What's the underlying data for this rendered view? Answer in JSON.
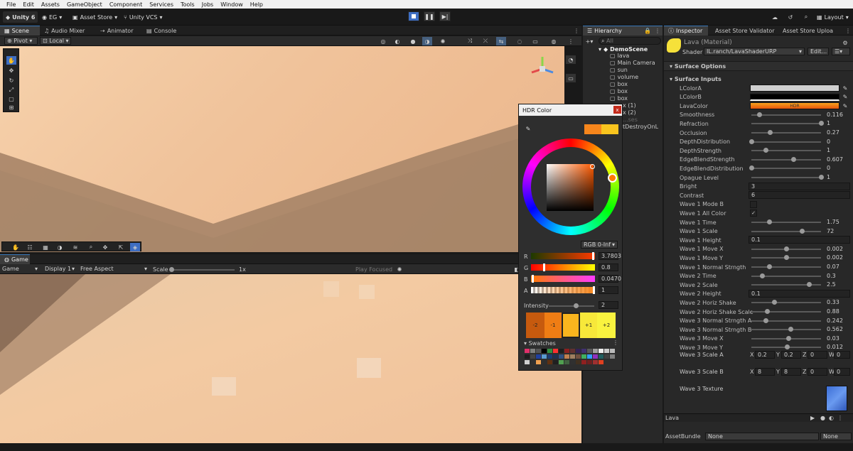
{
  "menu": [
    "File",
    "Edit",
    "Assets",
    "GameObject",
    "Component",
    "Services",
    "Tools",
    "Jobs",
    "Window",
    "Help"
  ],
  "toolbar": {
    "unity": "Unity 6",
    "account": "EG",
    "asset_store": "Asset Store",
    "vcs": "Unity VCS",
    "layout": "Layout"
  },
  "left_tabs": [
    "Scene",
    "Audio Mixer",
    "Animator",
    "Console"
  ],
  "scene_bar": {
    "pivot": "Pivot",
    "local": "Local"
  },
  "game_tab": "Game",
  "game_bar": {
    "mode": "Game",
    "display": "Display 1",
    "aspect": "Free Aspect",
    "scale_label": "Scale",
    "scale_value": "1x",
    "play_focused": "Play Focused"
  },
  "hierarchy": {
    "tab": "Hierarchy",
    "search_placeholder": "All",
    "scene": "DemoScene",
    "items": [
      "lava",
      "Main Camera",
      "sun",
      "volume",
      "box",
      "box",
      "box",
      "x (1)",
      "x (2)",
      "...ses",
      "tDestroyOnL"
    ]
  },
  "inspector": {
    "tabs": [
      "Inspector",
      "Asset Store Validator",
      "Asset Store Uploa"
    ],
    "material_name": "Lava (Material)",
    "shader_label": "Shader",
    "shader_value": "IL.ranch/LavaShaderURP",
    "edit_label": "Edit...",
    "surface_options": "Surface Options",
    "surface_inputs": "Surface Inputs",
    "hdr_label": "HDR",
    "props": [
      {
        "label": "LColorA",
        "type": "color",
        "color": "#cfcfcf"
      },
      {
        "label": "LColorB",
        "type": "color",
        "color": "#000000"
      },
      {
        "label": "LavaColor",
        "type": "hdr",
        "color": "#f7a21e"
      },
      {
        "label": "Smoothness",
        "type": "slider",
        "pos": 0.116,
        "value": "0.116"
      },
      {
        "label": "Refraction",
        "type": "slider",
        "pos": 1,
        "value": "1"
      },
      {
        "label": "Occlusion",
        "type": "slider",
        "pos": 0.27,
        "value": "0.27"
      },
      {
        "label": "DepthDistribution",
        "type": "slider",
        "pos": 0,
        "value": "0"
      },
      {
        "label": "DepthStrength",
        "type": "slider",
        "pos": 0.2,
        "value": "1"
      },
      {
        "label": "EdgeBlendStrength",
        "type": "slider",
        "pos": 0.607,
        "value": "0.607"
      },
      {
        "label": "EdgeBlendDistribution",
        "type": "slider",
        "pos": 0,
        "value": "0"
      },
      {
        "label": "Opague Level",
        "type": "slider",
        "pos": 1,
        "value": "1"
      },
      {
        "label": "Bright",
        "type": "field",
        "value": "3"
      },
      {
        "label": "Contrast",
        "type": "field",
        "value": "6"
      },
      {
        "label": "Wave 1 Mode B",
        "type": "check",
        "value": ""
      },
      {
        "label": "Wave 1 All Color",
        "type": "check",
        "value": "✓"
      },
      {
        "label": "Wave 1 Time",
        "type": "slider",
        "pos": 0.25,
        "value": "1.75"
      },
      {
        "label": "Wave 1 Scale",
        "type": "slider",
        "pos": 0.72,
        "value": "72"
      },
      {
        "label": "Wave 1 Height",
        "type": "field",
        "value": "0.1"
      },
      {
        "label": "Wave 1 Move X",
        "type": "slider",
        "pos": 0.5,
        "value": "0.002"
      },
      {
        "label": "Wave 1 Move Y",
        "type": "slider",
        "pos": 0.5,
        "value": "0.002"
      },
      {
        "label": "Wave 1 Normal Strngth",
        "type": "slider",
        "pos": 0.25,
        "value": "0.07"
      },
      {
        "label": "Wave 2 Time",
        "type": "slider",
        "pos": 0.15,
        "value": "0.3"
      },
      {
        "label": "Wave 2 Scale",
        "type": "slider",
        "pos": 0.83,
        "value": "2.5"
      },
      {
        "label": "Wave 2 Height",
        "type": "field",
        "value": "0.1"
      },
      {
        "label": "Wave 2 Horiz Shake",
        "type": "slider",
        "pos": 0.33,
        "value": "0.33"
      },
      {
        "label": "Wave 2 Horiz Shake Scale",
        "type": "slider",
        "pos": 0.22,
        "value": "0.88"
      },
      {
        "label": "Wave 3 Normal Strngth A",
        "type": "slider",
        "pos": 0.2,
        "value": "0.242"
      },
      {
        "label": "Wave 3 Normal Strngth B",
        "type": "slider",
        "pos": 0.56,
        "value": "0.562"
      },
      {
        "label": "Wave 3 Move X",
        "type": "slider",
        "pos": 0.53,
        "value": "0.03"
      },
      {
        "label": "Wave 3 Move Y",
        "type": "slider",
        "pos": 0.51,
        "value": "0.012"
      }
    ],
    "scale_a": {
      "label": "Wave 3 Scale A",
      "x": "0.2",
      "y": "0.2",
      "z": "0",
      "w": "0"
    },
    "scale_b": {
      "label": "Wave 3 Scale B",
      "x": "8",
      "y": "8",
      "z": "0",
      "w": "0"
    },
    "texture_label": "Wave 3 Texture",
    "footer_name": "Lava",
    "assetbundle_label": "AssetBundle",
    "assetbundle_value": "None",
    "assetbundle_variant": "None",
    "axis": {
      "x": "X",
      "y": "Y",
      "z": "Z",
      "w": "W"
    }
  },
  "hdr_picker": {
    "title": "HDR Color",
    "mode": "RGB 0-Inf",
    "r": {
      "label": "R",
      "value": "3.7803"
    },
    "g": {
      "label": "G",
      "value": "0.8"
    },
    "b": {
      "label": "B",
      "value": "0.0470"
    },
    "a": {
      "label": "A",
      "value": "1"
    },
    "intensity_label": "Intensity",
    "intensity_value": "2",
    "steps": [
      "-2",
      "-1",
      "",
      "+1",
      "+2"
    ],
    "swatches_label": "Swatches",
    "close": "x"
  }
}
